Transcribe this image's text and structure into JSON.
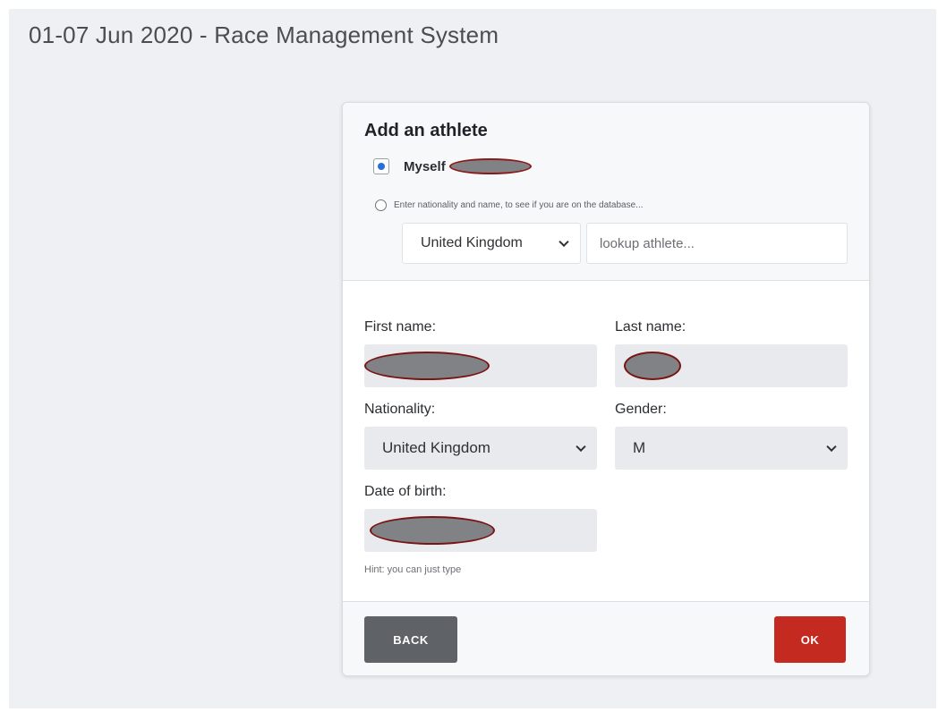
{
  "page": {
    "title": "01-07 Jun 2020 - Race Management System"
  },
  "dialog": {
    "title": "Add an athlete",
    "myself_label": "Myself",
    "lookup_hint": "Enter nationality and name, to see if you are on the database...",
    "lookup_country": "United Kingdom",
    "lookup_placeholder": "lookup athlete...",
    "first_name_label": "First name:",
    "last_name_label": "Last name:",
    "nationality_label": "Nationality:",
    "nationality_value": "United Kingdom",
    "gender_label": "Gender:",
    "gender_value": "M",
    "dob_label": "Date of birth:",
    "hint": "Hint: you can just type",
    "back_label": "BACK",
    "ok_label": "OK"
  },
  "colors": {
    "accent": "#2a6fd6",
    "ok_button": "#c42a20",
    "back_button": "#5f6368",
    "redaction_border": "#7a1515"
  },
  "icons": [
    "chevron-down-icon",
    "radio-selected-icon",
    "radio-empty-icon"
  ]
}
